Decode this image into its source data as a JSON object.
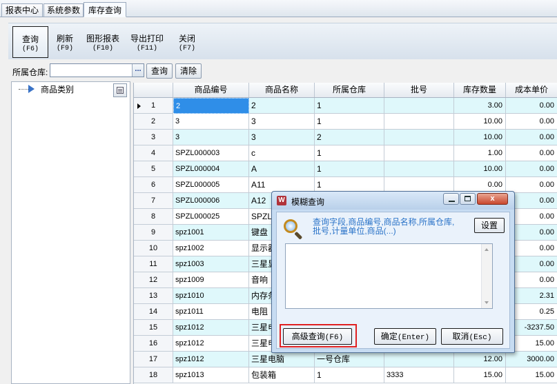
{
  "tabs": [
    {
      "label": "报表中心"
    },
    {
      "label": "系统参数"
    },
    {
      "label": "库存查询"
    }
  ],
  "toolbar": {
    "query": {
      "label": "查询",
      "key": "(F6)"
    },
    "refresh": {
      "label": "刷新",
      "key": "(F9)"
    },
    "graph_report": {
      "label": "图形报表",
      "key": "(F10)"
    },
    "export_print": {
      "label": "导出打印",
      "key": "(F11)"
    },
    "close": {
      "label": "关闭",
      "key": "(F7)"
    }
  },
  "filter": {
    "warehouse_label": "所属仓库:",
    "warehouse_value": "",
    "ellipsis": "...",
    "query_button": "查询",
    "clear_button": "清除"
  },
  "tree": {
    "root_label": "商品类别"
  },
  "grid": {
    "columns": [
      "商品编号",
      "商品名称",
      "所属仓库",
      "批号",
      "库存数量",
      "成本单价"
    ],
    "rows": [
      {
        "n": "1",
        "code": "2",
        "name": "2",
        "wh": "1",
        "batch": "",
        "qty": "3.00",
        "cost": "0.00"
      },
      {
        "n": "2",
        "code": "3",
        "name": "3",
        "wh": "1",
        "batch": "",
        "qty": "10.00",
        "cost": "0.00"
      },
      {
        "n": "3",
        "code": "3",
        "name": "3",
        "wh": "2",
        "batch": "",
        "qty": "10.00",
        "cost": "0.00"
      },
      {
        "n": "4",
        "code": "SPZL000003",
        "name": "c",
        "wh": "1",
        "batch": "",
        "qty": "1.00",
        "cost": "0.00"
      },
      {
        "n": "5",
        "code": "SPZL000004",
        "name": "A",
        "wh": "1",
        "batch": "",
        "qty": "10.00",
        "cost": "0.00"
      },
      {
        "n": "6",
        "code": "SPZL000005",
        "name": "A11",
        "wh": "1",
        "batch": "",
        "qty": "0.00",
        "cost": "0.00"
      },
      {
        "n": "7",
        "code": "SPZL000006",
        "name": "A12",
        "wh": "",
        "batch": "",
        "qty": "",
        "cost": "0.00"
      },
      {
        "n": "8",
        "code": "SPZL000025",
        "name": "SPZL",
        "wh": "",
        "batch": "",
        "qty": "",
        "cost": "0.00"
      },
      {
        "n": "9",
        "code": "spz1001",
        "name": "键盘",
        "wh": "",
        "batch": "",
        "qty": "",
        "cost": "0.00"
      },
      {
        "n": "10",
        "code": "spz1002",
        "name": "显示器",
        "wh": "",
        "batch": "",
        "qty": "",
        "cost": "0.00"
      },
      {
        "n": "11",
        "code": "spz1003",
        "name": "三星显",
        "wh": "",
        "batch": "",
        "qty": "",
        "cost": "0.00"
      },
      {
        "n": "12",
        "code": "spz1009",
        "name": "音响",
        "wh": "",
        "batch": "",
        "qty": "",
        "cost": "0.00"
      },
      {
        "n": "13",
        "code": "spz1010",
        "name": "内存条",
        "wh": "",
        "batch": "",
        "qty": "",
        "cost": "2.31"
      },
      {
        "n": "14",
        "code": "spz1011",
        "name": "电阻",
        "wh": "",
        "batch": "",
        "qty": "",
        "cost": "0.25"
      },
      {
        "n": "15",
        "code": "spz1012",
        "name": "三星电",
        "wh": "",
        "batch": "",
        "qty": "",
        "cost": "-3237.50"
      },
      {
        "n": "16",
        "code": "spz1012",
        "name": "三星电",
        "wh": "",
        "batch": "",
        "qty": "",
        "cost": "15.00"
      },
      {
        "n": "17",
        "code": "spz1012",
        "name": "三星电脑",
        "wh": "一号仓库",
        "batch": "",
        "qty": "12.00",
        "cost": "3000.00"
      },
      {
        "n": "18",
        "code": "spz1013",
        "name": "包装箱",
        "wh": "1",
        "batch": "3333",
        "qty": "15.00",
        "cost": "15.00"
      }
    ]
  },
  "dialog": {
    "title": "模糊查询",
    "hint": "查询字段,商品编号,商品名称,所属仓库,批号,计量单位,商品(...)",
    "settings_button": "设置",
    "advanced_button_label": "高级查询",
    "advanced_button_key": "(F6)",
    "ok_button_label": "确定",
    "ok_button_key": "(Enter)",
    "cancel_button_label": "取消",
    "cancel_button_key": "(Esc)",
    "input_value": "",
    "close_glyph": "x"
  },
  "colors": {
    "grid_alt_row": "#dff8fb",
    "selection": "#2f8ee8",
    "hint_text": "#2a73c8",
    "highlight": "#e02020"
  }
}
